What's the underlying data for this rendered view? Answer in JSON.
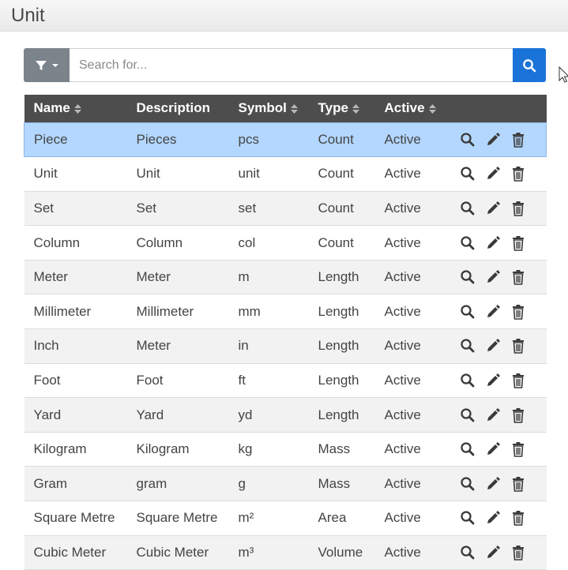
{
  "header": {
    "title": "Unit"
  },
  "search": {
    "placeholder": "Search for..."
  },
  "table": {
    "columns": [
      {
        "label": "Name",
        "sortable": true
      },
      {
        "label": "Description",
        "sortable": false
      },
      {
        "label": "Symbol",
        "sortable": true
      },
      {
        "label": "Type",
        "sortable": true
      },
      {
        "label": "Active",
        "sortable": true
      },
      {
        "label": "",
        "sortable": false
      }
    ],
    "rows": [
      {
        "name": "Piece",
        "description": "Pieces",
        "symbol": "pcs",
        "type": "Count",
        "active": "Active",
        "selected": true
      },
      {
        "name": "Unit",
        "description": "Unit",
        "symbol": "unit",
        "type": "Count",
        "active": "Active"
      },
      {
        "name": "Set",
        "description": "Set",
        "symbol": "set",
        "type": "Count",
        "active": "Active"
      },
      {
        "name": "Column",
        "description": "Column",
        "symbol": "col",
        "type": "Count",
        "active": "Active"
      },
      {
        "name": "Meter",
        "description": "Meter",
        "symbol": "m",
        "type": "Length",
        "active": "Active"
      },
      {
        "name": "Millimeter",
        "description": "Millimeter",
        "symbol": "mm",
        "type": "Length",
        "active": "Active"
      },
      {
        "name": "Inch",
        "description": "Meter",
        "symbol": "in",
        "type": "Length",
        "active": "Active"
      },
      {
        "name": "Foot",
        "description": "Foot",
        "symbol": "ft",
        "type": "Length",
        "active": "Active"
      },
      {
        "name": "Yard",
        "description": "Yard",
        "symbol": "yd",
        "type": "Length",
        "active": "Active"
      },
      {
        "name": "Kilogram",
        "description": "Kilogram",
        "symbol": "kg",
        "type": "Mass",
        "active": "Active"
      },
      {
        "name": "Gram",
        "description": "gram",
        "symbol": "g",
        "type": "Mass",
        "active": "Active"
      },
      {
        "name": "Square Metre",
        "description": "Square Metre",
        "symbol": "m²",
        "type": "Area",
        "active": "Active"
      },
      {
        "name": "Cubic Meter",
        "description": "Cubic Meter",
        "symbol": "m³",
        "type": "Volume",
        "active": "Active"
      }
    ],
    "row_actions": [
      "view-icon",
      "edit-icon",
      "delete-icon"
    ]
  },
  "colors": {
    "header_bg": "#4d4d4d",
    "selected_row": "#b3d7ff",
    "search_button": "#1a73d9",
    "filter_button": "#7b838b"
  }
}
